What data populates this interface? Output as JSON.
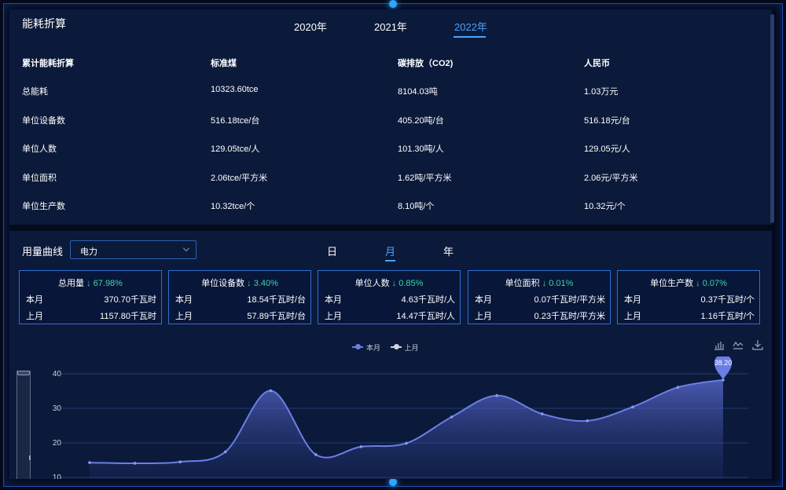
{
  "top": {
    "title": "能耗折算",
    "years": [
      "2020年",
      "2021年",
      "2022年"
    ],
    "active_year": "2022年",
    "table": {
      "headers": [
        "累计能耗折算",
        "标准煤",
        "碳排放（CO2)",
        "人民币"
      ],
      "rows": [
        [
          "总能耗",
          "10323.60tce",
          "8104.03吨",
          "1.03万元"
        ],
        [
          "单位设备数",
          "516.18tce/台",
          "405.20吨/台",
          "516.18元/台"
        ],
        [
          "单位人数",
          "129.05tce/人",
          "101.30吨/人",
          "129.05元/人"
        ],
        [
          "单位面积",
          "2.06tce/平方米",
          "1.62吨/平方米",
          "2.06元/平方米"
        ],
        [
          "单位生产数",
          "10.32tce/个",
          "8.10吨/个",
          "10.32元/个"
        ]
      ]
    }
  },
  "usage": {
    "label": "用量曲线",
    "select_value": "电力",
    "periods": [
      "日",
      "月",
      "年"
    ],
    "active_period": "月",
    "cards": [
      {
        "title": "总用量",
        "pct": "↓ 67.98%",
        "cur_label": "本月",
        "cur_value": "370.70千瓦时",
        "prev_label": "上月",
        "prev_value": "1157.80千瓦时"
      },
      {
        "title": "单位设备数",
        "pct": "↓ 3.40%",
        "cur_label": "本月",
        "cur_value": "18.54千瓦时/台",
        "prev_label": "上月",
        "prev_value": "57.89千瓦时/台"
      },
      {
        "title": "单位人数",
        "pct": "↓ 0.85%",
        "cur_label": "本月",
        "cur_value": "4.63千瓦时/人",
        "prev_label": "上月",
        "prev_value": "14.47千瓦时/人"
      },
      {
        "title": "单位面积",
        "pct": "↓ 0.01%",
        "cur_label": "本月",
        "cur_value": "0.07千瓦时/平方米",
        "prev_label": "上月",
        "prev_value": "0.23千瓦时/平方米"
      },
      {
        "title": "单位生产数",
        "pct": "↓ 0.07%",
        "cur_label": "本月",
        "cur_value": "0.37千瓦时/个",
        "prev_label": "上月",
        "prev_value": "1.16千瓦时/个"
      }
    ]
  },
  "colors": {
    "accent": "#4aa3ff",
    "series_current": "#6b7ee8",
    "series_previous": "#d0d4dc",
    "positive_change": "#3fd6a4"
  },
  "icons": [
    "bar-chart-icon",
    "line-chart-icon",
    "download-icon"
  ],
  "chart_data": {
    "type": "area",
    "legend": [
      "本月",
      "上月"
    ],
    "legend_position": "top-center",
    "grid": true,
    "yticks": [
      "40",
      "30",
      "20",
      "10"
    ],
    "ylim": [
      10,
      40
    ],
    "series": [
      {
        "name": "本月",
        "values": [
          14.3,
          14.1,
          14.5,
          17.4,
          35.1,
          16.6,
          18.9,
          19.9,
          27.5,
          33.7,
          28.4,
          26.4,
          30.4,
          36.1,
          38.2
        ]
      }
    ],
    "max_label": "38.20"
  }
}
